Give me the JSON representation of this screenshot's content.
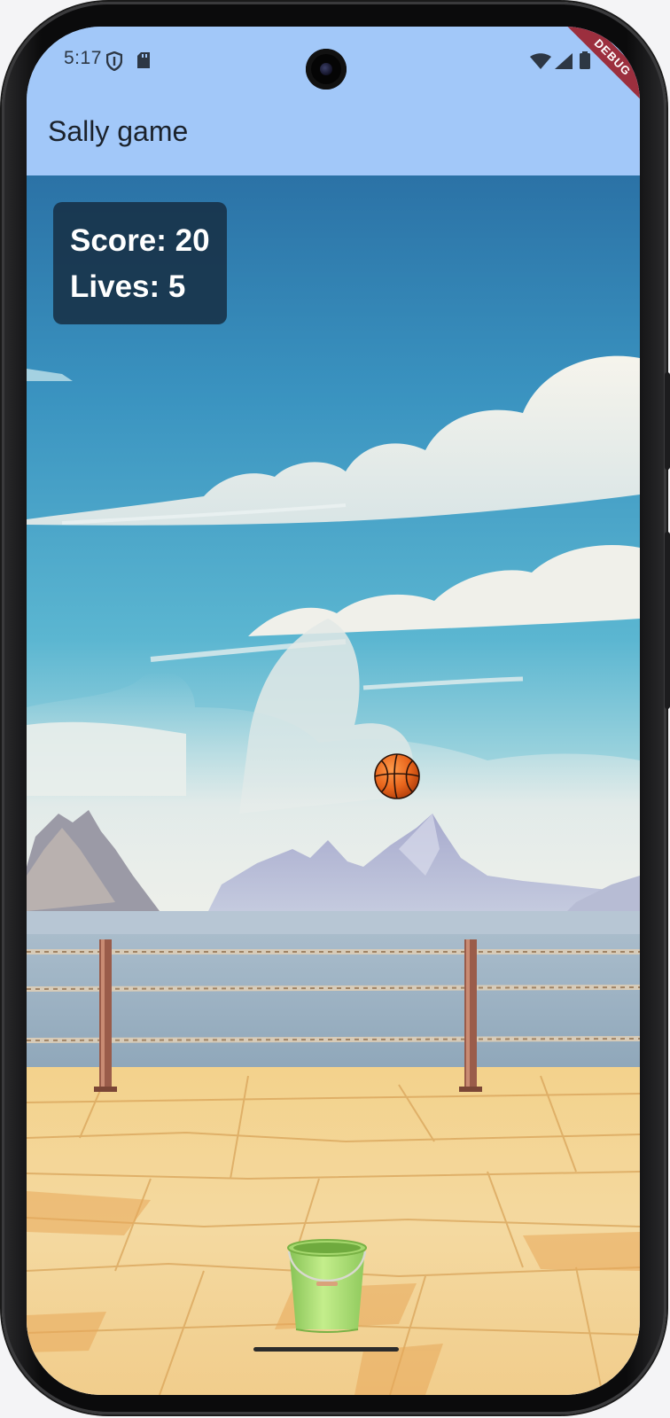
{
  "status_bar": {
    "time": "5:17",
    "icons": [
      "shield-icon",
      "sd-card-icon",
      "wifi-icon",
      "cell-signal-icon",
      "battery-icon"
    ]
  },
  "debug_banner": "DEBUG",
  "app_bar": {
    "title": "Sally game"
  },
  "hud": {
    "score_text": "Score: 20",
    "lives_text": "Lives: 5"
  },
  "game": {
    "objects": [
      "basketball",
      "bucket"
    ]
  },
  "colors": {
    "app_bar": "#a2c8f9",
    "hud_background": "#173046",
    "debug_banner": "#9c2f3e",
    "bucket": "#a8dc6e",
    "ball": "#e8651c"
  }
}
